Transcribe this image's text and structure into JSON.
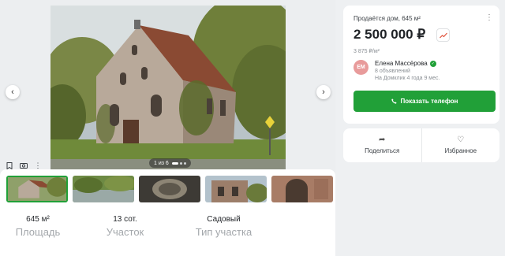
{
  "gallery": {
    "counter_text": "1 из 6",
    "thumbnails": [
      {
        "name": "thumb-facade"
      },
      {
        "name": "thumb-pond"
      },
      {
        "name": "thumb-interior"
      },
      {
        "name": "thumb-ruins"
      },
      {
        "name": "thumb-arch"
      }
    ]
  },
  "facts": [
    {
      "value": "645 м²",
      "label": "Площадь"
    },
    {
      "value": "13 сот.",
      "label": "Участок"
    },
    {
      "value": "Садовый",
      "label": "Тип участка"
    }
  ],
  "listing": {
    "title": "Продаётся дом, 645 м²",
    "price": "2 500 000 ₽",
    "price_per_m2": "3 875 ₽/м²",
    "agent_initials": "ЕМ",
    "agent_name": "Елена Массёрова",
    "agent_ads": "8 объявлений",
    "agent_since": "На Домклик 4 года 9 мес.",
    "call_button": "Показать телефон"
  },
  "actions": {
    "share_label": "Поделиться",
    "favorite_label": "Избранное"
  },
  "colors": {
    "accent": "#21a038",
    "avatar": "#e89b9b"
  }
}
